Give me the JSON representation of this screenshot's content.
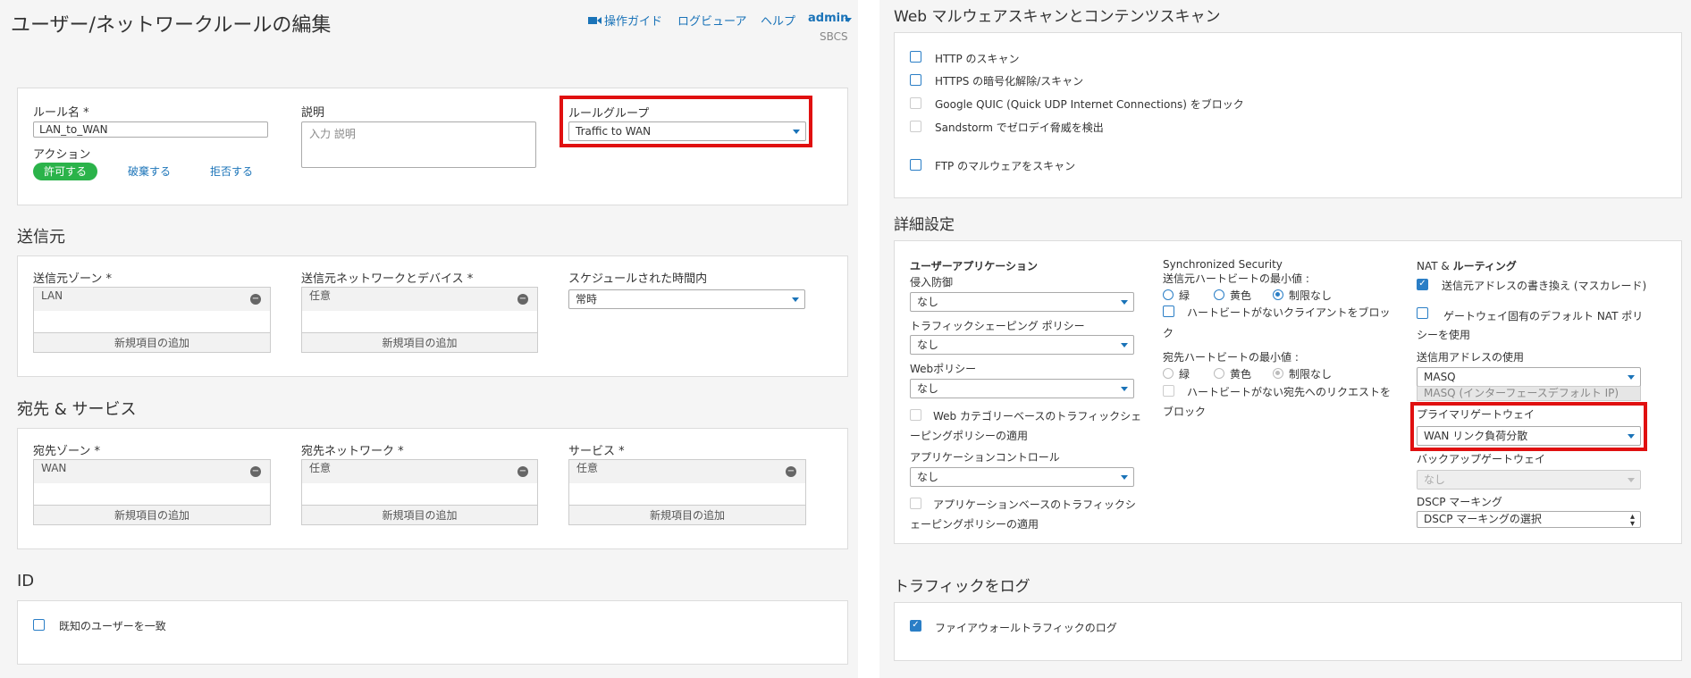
{
  "left": {
    "page_title": "ユーザー/ネットワークルールの編集",
    "header_links": {
      "guide": "操作ガイド",
      "logviewer": "ログビューア",
      "help": "ヘルプ",
      "admin": "admin"
    },
    "device_name": "SBCS",
    "rule": {
      "name_label": "ルール名 *",
      "name_value": "LAN_to_WAN",
      "action_label": "アクション",
      "actions": [
        "許可する",
        "破棄する",
        "拒否する"
      ],
      "desc_label": "説明",
      "desc_placeholder": "入力 説明",
      "group_label": "ルールグループ",
      "group_value": "Traffic to WAN"
    },
    "source": {
      "title": "送信元",
      "zone_label": "送信元ゾーン *",
      "zone_value": "LAN",
      "net_label": "送信元ネットワークとデバイス *",
      "net_value": "任意",
      "schedule_label": "スケジュールされた時間内",
      "schedule_value": "常時",
      "add_item": "新規項目の追加"
    },
    "dest": {
      "title": "宛先 & サービス",
      "zone_label": "宛先ゾーン *",
      "zone_value": "WAN",
      "net_label": "宛先ネットワーク *",
      "net_value": "任意",
      "service_label": "サービス *",
      "service_value": "任意",
      "add_item": "新規項目の追加"
    },
    "id": {
      "title": "ID",
      "match_users": "既知のユーザーを一致"
    }
  },
  "right": {
    "scan": {
      "title": "Web マルウェアスキャンとコンテンツスキャン",
      "http": "HTTP のスキャン",
      "https": "HTTPS の暗号化解除/スキャン",
      "quic": "Google QUIC (Quick UDP Internet Connections) をブロック",
      "sandstorm": "Sandstorm でゼロデイ脅威を検出",
      "ftp": "FTP のマルウェアをスキャン"
    },
    "advanced": {
      "title": "詳細設定",
      "user_apps": "ユーザーアプリケーション",
      "ips_label": "侵入防御",
      "ips_value": "なし",
      "shaping_label": "トラフィックシェーピング ポリシー",
      "shaping_value": "なし",
      "web_label": "Webポリシー",
      "web_value": "なし",
      "webcat_1": "Web カテゴリーベースのトラフィックシェ",
      "webcat_2": "ーピングポリシーの適用",
      "appctrl_label": "アプリケーションコントロール",
      "appctrl_value": "なし",
      "appshape_1": "アプリケーションベースのトラフィックシ",
      "appshape_2": "ェーピングポリシーの適用",
      "sync_title": "Synchronized Security",
      "src_hb_label": "送信元ハートビートの最小値 :",
      "hb_options": [
        "緑",
        "黄色",
        "制限なし"
      ],
      "no_hb_clients_1": "ハートビートがないクライアントをブロッ",
      "no_hb_clients_2": "ク",
      "dst_hb_label": "宛先ハートビートの最小値 :",
      "no_hb_dest_1": "ハートビートがない宛先へのリクエストを",
      "no_hb_dest_2": "ブロック",
      "nat_title_1": "NAT &",
      "nat_title_2": "ルーティング",
      "masq_label": "送信元アドレスの書き換え (マスカレード)",
      "gw_nat_1": "ゲートウェイ固有のデフォルト NAT ポリ",
      "gw_nat_2": "シーを使用",
      "src_addr_label": "送信用アドレスの使用",
      "src_addr_value": "MASQ",
      "src_addr_option": "MASQ (インターフェースデフォルト IP)",
      "primary_gw_label": "プライマリゲートウェイ",
      "primary_gw_value": "WAN リンク負荷分散",
      "backup_gw_label": "バックアップゲートウェイ",
      "backup_gw_value": "なし",
      "dscp_label": "DSCP マーキング",
      "dscp_value": "DSCP マーキングの選択"
    },
    "log": {
      "title": "トラフィックをログ",
      "fw_log": "ファイアウォールトラフィックのログ"
    }
  },
  "colors": {
    "accent": "#1a73b8",
    "allow_green": "#2bb34a",
    "highlight_red": "#e01010"
  }
}
